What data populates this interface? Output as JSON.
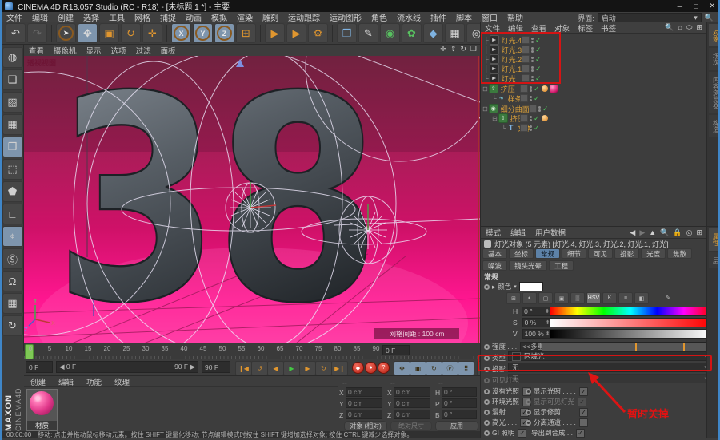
{
  "window": {
    "title": "CINEMA 4D R18.057 Studio (RC - R18) - [未标题 1 *] - 主要",
    "min": "─",
    "max": "□",
    "close": "✕"
  },
  "menubar": {
    "items": [
      "文件",
      "编辑",
      "创建",
      "选择",
      "工具",
      "网格",
      "捕捉",
      "动画",
      "模拟",
      "渲染",
      "雕刻",
      "运动跟踪",
      "运动图形",
      "角色",
      "流水线",
      "插件",
      "脚本",
      "窗口",
      "帮助"
    ],
    "interface_label": "界面:",
    "interface_value": "启动"
  },
  "toolbar": {
    "undo": "↶",
    "redo": "↷",
    "select": "➤",
    "move": "✥",
    "scale": "▣",
    "rotate": "↻",
    "last_tool": "✛",
    "x": "X",
    "y": "Y",
    "z": "Z",
    "coords": "⊞",
    "render_view": "▶",
    "render_picture": "▶",
    "render_settings": "⚙",
    "cube": "❒",
    "pen": "✎",
    "subdiv": "◉",
    "mograph": "✿",
    "deformer": "◆",
    "floor": "▦",
    "camera": "◎",
    "light": "⌾"
  },
  "left_toolbar": {
    "convert": "◍",
    "model": "❑",
    "texture": "▨",
    "uv": "▦",
    "object": "❒",
    "points": "⬚",
    "polygons": "⬟",
    "axis": "∟",
    "solo": "⌖",
    "snap_s": "Ⓢ",
    "magnet": "Ω",
    "plane_lock": "▦",
    "plane_refresh": "↻"
  },
  "viewport": {
    "menus": [
      "查看",
      "摄像机",
      "显示",
      "选项",
      "过滤",
      "面板"
    ],
    "nav_icons": [
      "✛",
      "⇕",
      "↻",
      "❐"
    ],
    "label": "透视视图",
    "digits": "38",
    "grid_label": "网格间距 : 100 cm"
  },
  "timeline": {
    "ticks": [
      "0",
      "5",
      "10",
      "15",
      "20",
      "25",
      "30",
      "35",
      "40",
      "45",
      "50",
      "55",
      "60",
      "65",
      "70",
      "75",
      "80",
      "85",
      "90"
    ],
    "cur_field": "0 F",
    "range_left": "◀ 0 F",
    "range_right": "90 F ▶",
    "start_field": "0 F",
    "end_field": "90 F",
    "transport": [
      "❙◀",
      "↺",
      "◀",
      "▶",
      "▶",
      "↻",
      "▶❙"
    ],
    "records": [
      "◆",
      "●",
      "?"
    ],
    "keys": [
      "✥",
      "▣",
      "↻",
      "Ⓟ",
      "⠿"
    ],
    "bars": "≡"
  },
  "brand": {
    "maxon": "MAXON",
    "c4d": "CINEMA4D"
  },
  "materials": {
    "menus": [
      "创建",
      "编辑",
      "功能",
      "纹理"
    ],
    "material_name": "材质"
  },
  "coords": {
    "headers": [
      "--",
      "--",
      "--"
    ],
    "col1": {
      "x_label": "X",
      "y_label": "Y",
      "z_label": "Z",
      "x": "0 cm",
      "y": "0 cm",
      "z": "0 cm"
    },
    "col2": {
      "x_label": "X",
      "y_label": "Y",
      "z_label": "Z",
      "x": "0 cm",
      "y": "0 cm",
      "z": "0 cm"
    },
    "col3": {
      "h_label": "H",
      "p_label": "P",
      "b_label": "B",
      "h": "0 °",
      "p": "0 °",
      "b": "0 °"
    },
    "mode": "对象 (相对)",
    "size_mode": "绝对尺寸",
    "apply": "应用"
  },
  "statusbar": {
    "time": "00:00:00",
    "text": "移动: 点击并拖动鼠标移动元素。按住 SHIFT 键量化移动; 节点编辑模式时按住 SHIFT 键增加选择对象; 按住 CTRL 键减少选择对象。"
  },
  "object_manager": {
    "menus": [
      "文件",
      "编辑",
      "查看",
      "对象",
      "标签",
      "书签"
    ],
    "corner_icons": [
      "🔍",
      "⌂",
      "⬭",
      "⊞"
    ],
    "side_tabs": [
      "对象",
      "场次",
      "内容浏览器",
      "构造"
    ],
    "objects": [
      {
        "name": "灯光.4"
      },
      {
        "name": "灯光.3"
      },
      {
        "name": "灯光.2"
      },
      {
        "name": "灯光.1"
      },
      {
        "name": "灯光"
      },
      {
        "name": "挤压"
      },
      {
        "name": "样条"
      },
      {
        "name": "细分曲面"
      },
      {
        "name": "挤压"
      },
      {
        "name": "文本"
      }
    ],
    "check": "✓"
  },
  "attribute_manager": {
    "menus": [
      "模式",
      "编辑",
      "用户数据"
    ],
    "nav_icons": [
      "◀",
      "▶",
      "▲",
      "🔍",
      "🔒",
      "◎",
      "⊞"
    ],
    "side_tabs": [
      "属性",
      "层"
    ],
    "title": "灯光对象 (5 元素) [灯光.4, 灯光.3, 灯光.2, 灯光.1, 灯光]",
    "tabs": [
      "基本",
      "坐标",
      "常规",
      "细节",
      "可见",
      "投影",
      "光度",
      "焦散",
      "噪波",
      "镜头光晕",
      "工程"
    ],
    "section": "常规",
    "color_label": "颜色",
    "color_icons": [
      "⊞",
      "◐",
      "▢",
      "▣",
      "▒",
      "HSV",
      "K",
      "≡",
      "◧",
      "✎"
    ],
    "h_label": "H",
    "h_value": "0 °",
    "s_label": "S",
    "s_value": "0 %",
    "v_label": "V",
    "v_value": "100 %",
    "intensity_label": "强度 . . .",
    "intensity_value": "<<多重数值",
    "type_label": "类型 . . .",
    "type_value": "区域光",
    "shadow_label": "投影 . . .",
    "shadow_value": "无",
    "visible_label": "可见灯光",
    "visible_value": "无",
    "checks_left": [
      {
        "label": "没有光照",
        "check": ""
      },
      {
        "label": "环境光照",
        "check": ""
      },
      {
        "label": "漫射 . . .",
        "check": "✓"
      },
      {
        "label": "高光 . . .",
        "check": "✓"
      },
      {
        "label": "GI 照明",
        "check": "✓"
      }
    ],
    "checks_right": [
      {
        "label": "显示光照 . . . .",
        "check": "✓"
      },
      {
        "label": "显示可见灯光",
        "check": "✓"
      },
      {
        "label": "显示修剪 . . . .",
        "check": "✓"
      },
      {
        "label": "分离通道 . . . .",
        "check": ""
      },
      {
        "label": "导出到合成 . .",
        "check": "✓"
      }
    ]
  },
  "annotations": {
    "note": "暂时关掉"
  },
  "colors": {
    "accent_blue": "#5d82a8",
    "object_orange": "#d79e3a",
    "annotation_red": "#d41414",
    "check_green": "#4dc05a",
    "viewport_pink": "#ff1690"
  }
}
